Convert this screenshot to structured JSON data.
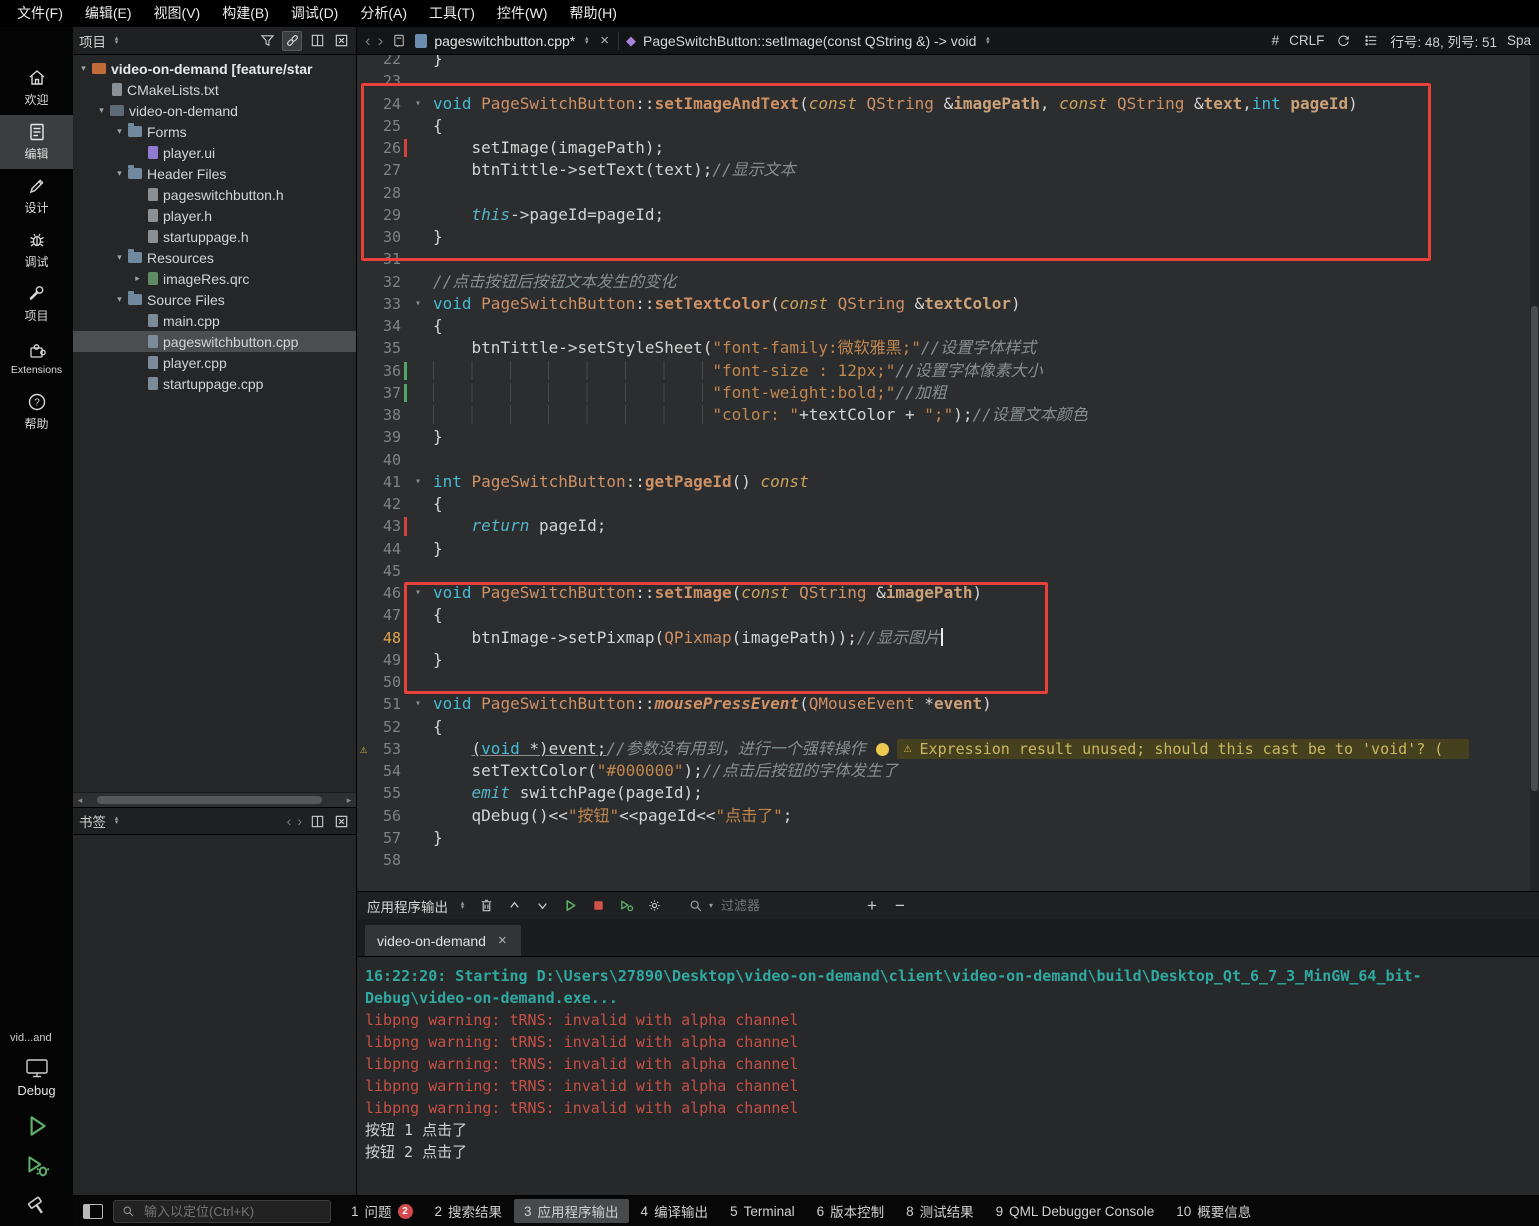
{
  "menubar": {
    "items": [
      "文件(F)",
      "编辑(E)",
      "视图(V)",
      "构建(B)",
      "调试(D)",
      "分析(A)",
      "工具(T)",
      "控件(W)",
      "帮助(H)"
    ]
  },
  "modebar": {
    "items": [
      {
        "label": "欢迎"
      },
      {
        "label": "编辑",
        "active": true
      },
      {
        "label": "设计"
      },
      {
        "label": "调试"
      },
      {
        "label": "项目"
      },
      {
        "label": "Extensions"
      },
      {
        "label": "帮助"
      }
    ],
    "kit_project": "vid...and",
    "kit_config": "Debug"
  },
  "project_pane": {
    "title": "项目",
    "tree": [
      {
        "d": 0,
        "arrow": "▾",
        "icon": "project",
        "label": "video-on-demand [feature/star",
        "bold": true
      },
      {
        "d": 1,
        "arrow": "",
        "icon": "file",
        "label": "CMakeLists.txt"
      },
      {
        "d": 1,
        "arrow": "▾",
        "icon": "app",
        "label": "video-on-demand"
      },
      {
        "d": 2,
        "arrow": "▾",
        "icon": "folder",
        "label": "Forms"
      },
      {
        "d": 3,
        "arrow": "",
        "icon": "ui",
        "label": "player.ui"
      },
      {
        "d": 2,
        "arrow": "▾",
        "icon": "folder",
        "label": "Header Files"
      },
      {
        "d": 3,
        "arrow": "",
        "icon": "h",
        "label": "pageswitchbutton.h"
      },
      {
        "d": 3,
        "arrow": "",
        "icon": "h",
        "label": "player.h"
      },
      {
        "d": 3,
        "arrow": "",
        "icon": "h",
        "label": "startuppage.h"
      },
      {
        "d": 2,
        "arrow": "▾",
        "icon": "folder",
        "label": "Resources"
      },
      {
        "d": 3,
        "arrow": "▸",
        "icon": "qrc",
        "label": "imageRes.qrc"
      },
      {
        "d": 2,
        "arrow": "▾",
        "icon": "folder",
        "label": "Source Files"
      },
      {
        "d": 3,
        "arrow": "",
        "icon": "cpp",
        "label": "main.cpp"
      },
      {
        "d": 3,
        "arrow": "",
        "icon": "cpp",
        "label": "pageswitchbutton.cpp",
        "selected": true
      },
      {
        "d": 3,
        "arrow": "",
        "icon": "cpp",
        "label": "player.cpp"
      },
      {
        "d": 3,
        "arrow": "",
        "icon": "cpp",
        "label": "startuppage.cpp"
      }
    ]
  },
  "bookmarks_pane": {
    "title": "书签"
  },
  "editor_toolbar": {
    "back": "‹",
    "forward": "›",
    "file": "pageswitchbutton.cpp*",
    "close": "×",
    "symbol": "PageSwitchButton::setImage(const QString &) -> void",
    "hash": "#",
    "line_ending": "CRLF",
    "cursor_pos": "行号: 48, 列号: 51",
    "trail": "Spa"
  },
  "editor": {
    "annotations": {
      "box_color": "#E8413C",
      "boxes": [
        {
          "covers_lines": "24-30"
        },
        {
          "covers_lines": "46-49"
        }
      ]
    },
    "lines": [
      {
        "n": 22,
        "segs": [
          [
            "o",
            "}"
          ]
        ]
      },
      {
        "n": 23,
        "segs": []
      },
      {
        "n": 24,
        "fold": true,
        "segs": [
          [
            "k",
            "void "
          ],
          [
            "t",
            "PageSwitchButton"
          ],
          [
            "o",
            "::"
          ],
          [
            "fn",
            "setImageAndText"
          ],
          [
            "o",
            "("
          ],
          [
            "kc",
            "const "
          ],
          [
            "t",
            "QString "
          ],
          [
            "o",
            "&"
          ],
          [
            "p",
            "imagePath"
          ],
          [
            "o",
            ", "
          ],
          [
            "kc",
            "const "
          ],
          [
            "t",
            "QString "
          ],
          [
            "o",
            "&"
          ],
          [
            "p",
            "text"
          ],
          [
            "o",
            ","
          ],
          [
            "k",
            "int "
          ],
          [
            "p",
            "pageId"
          ],
          [
            "o",
            ")"
          ]
        ]
      },
      {
        "n": 25,
        "segs": [
          [
            "o",
            "{"
          ]
        ]
      },
      {
        "n": 26,
        "mark": "red",
        "segs": [
          [
            "o",
            "    setImage(imagePath);"
          ]
        ]
      },
      {
        "n": 27,
        "segs": [
          [
            "o",
            "    btnTittle->setText(text);"
          ],
          [
            "c",
            "//显示文本"
          ]
        ]
      },
      {
        "n": 28,
        "segs": []
      },
      {
        "n": 29,
        "segs": [
          [
            "o",
            "    "
          ],
          [
            "kf",
            "this"
          ],
          [
            "o",
            "->pageId=pageId;"
          ]
        ]
      },
      {
        "n": 30,
        "segs": [
          [
            "o",
            "}"
          ]
        ]
      },
      {
        "n": 31,
        "segs": []
      },
      {
        "n": 32,
        "segs": [
          [
            "c",
            "//点击按钮后按钮文本发生的变化"
          ]
        ]
      },
      {
        "n": 33,
        "fold": true,
        "segs": [
          [
            "k",
            "void "
          ],
          [
            "t",
            "PageSwitchButton"
          ],
          [
            "o",
            "::"
          ],
          [
            "fn",
            "setTextColor"
          ],
          [
            "o",
            "("
          ],
          [
            "kc",
            "const "
          ],
          [
            "t",
            "QString "
          ],
          [
            "o",
            "&"
          ],
          [
            "p",
            "textColor"
          ],
          [
            "o",
            ")"
          ]
        ]
      },
      {
        "n": 34,
        "segs": [
          [
            "o",
            "{"
          ]
        ]
      },
      {
        "n": 35,
        "segs": [
          [
            "o",
            "    btnTittle->setStyleSheet("
          ],
          [
            "s",
            "\"font-family:微软雅黑;\""
          ],
          [
            "c",
            "//设置字体样式"
          ]
        ]
      },
      {
        "n": 36,
        "mark": "green",
        "segs": [
          [
            "g",
            "                             "
          ],
          [
            "s",
            "\"font-size : 12px;\""
          ],
          [
            "c",
            "//设置字体像素大小"
          ]
        ]
      },
      {
        "n": 37,
        "mark": "green",
        "segs": [
          [
            "g",
            "                             "
          ],
          [
            "s",
            "\"font-weight:bold;\""
          ],
          [
            "c",
            "//加粗"
          ]
        ]
      },
      {
        "n": 38,
        "segs": [
          [
            "g",
            "                             "
          ],
          [
            "s",
            "\"color: \""
          ],
          [
            "o",
            "+textColor + "
          ],
          [
            "s",
            "\";\""
          ],
          [
            "o",
            ");"
          ],
          [
            "c",
            "//设置文本颜色"
          ]
        ]
      },
      {
        "n": 39,
        "segs": [
          [
            "o",
            "}"
          ]
        ]
      },
      {
        "n": 40,
        "segs": []
      },
      {
        "n": 41,
        "fold": true,
        "segs": [
          [
            "k",
            "int "
          ],
          [
            "t",
            "PageSwitchButton"
          ],
          [
            "o",
            "::"
          ],
          [
            "fn",
            "getPageId"
          ],
          [
            "o",
            "() "
          ],
          [
            "kc",
            "const"
          ]
        ]
      },
      {
        "n": 42,
        "segs": [
          [
            "o",
            "{"
          ]
        ]
      },
      {
        "n": 43,
        "mark": "red",
        "segs": [
          [
            "o",
            "    "
          ],
          [
            "kf",
            "return"
          ],
          [
            "o",
            " pageId;"
          ]
        ]
      },
      {
        "n": 44,
        "segs": [
          [
            "o",
            "}"
          ]
        ]
      },
      {
        "n": 45,
        "segs": []
      },
      {
        "n": 46,
        "fold": true,
        "segs": [
          [
            "k",
            "void "
          ],
          [
            "t",
            "PageSwitchButton"
          ],
          [
            "o",
            "::"
          ],
          [
            "fn",
            "setImage"
          ],
          [
            "o",
            "("
          ],
          [
            "kc",
            "const "
          ],
          [
            "t",
            "QString "
          ],
          [
            "o",
            "&"
          ],
          [
            "p",
            "imagePath"
          ],
          [
            "o",
            ")"
          ]
        ]
      },
      {
        "n": 47,
        "segs": [
          [
            "o",
            "{"
          ]
        ]
      },
      {
        "n": 48,
        "cur": true,
        "segs": [
          [
            "o",
            "    btnImage->setPixmap("
          ],
          [
            "t",
            "QPixmap"
          ],
          [
            "o",
            "(imagePath));"
          ],
          [
            "c",
            "//显示图片"
          ],
          [
            "cursor",
            ""
          ]
        ]
      },
      {
        "n": 49,
        "segs": [
          [
            "o",
            "}"
          ]
        ]
      },
      {
        "n": 50,
        "segs": []
      },
      {
        "n": 51,
        "fold": true,
        "segs": [
          [
            "k",
            "void "
          ],
          [
            "t",
            "PageSwitchButton"
          ],
          [
            "o",
            "::"
          ],
          [
            "vf",
            "mousePressEvent"
          ],
          [
            "o",
            "("
          ],
          [
            "t",
            "QMouseEvent "
          ],
          [
            "o",
            "*"
          ],
          [
            "p",
            "event"
          ],
          [
            "o",
            ")"
          ]
        ]
      },
      {
        "n": 52,
        "segs": [
          [
            "o",
            "{"
          ]
        ]
      },
      {
        "n": 53,
        "warn": true,
        "segs": [
          [
            "o",
            "    "
          ],
          [
            "o u",
            "("
          ],
          [
            "k u",
            "void"
          ],
          [
            "o u",
            " *)event;"
          ],
          [
            "c",
            "//参数没有用到，进行一个强转操作"
          ],
          [
            "bulb",
            ""
          ],
          [
            "chip",
            "Expression result unused; should this cast be to 'void'? ("
          ]
        ]
      },
      {
        "n": 54,
        "segs": [
          [
            "o",
            "    setTextColor("
          ],
          [
            "s",
            "\"#000000\""
          ],
          [
            "o",
            ");"
          ],
          [
            "c",
            "//点击后按钮的字体发生了"
          ]
        ]
      },
      {
        "n": 55,
        "segs": [
          [
            "o",
            "    "
          ],
          [
            "kf",
            "emit"
          ],
          [
            "o",
            " switchPage(pageId);"
          ]
        ]
      },
      {
        "n": 56,
        "segs": [
          [
            "o",
            "    qDebug()<<"
          ],
          [
            "s",
            "\"按钮\""
          ],
          [
            "o",
            "<<pageId<<"
          ],
          [
            "s",
            "\"点击了\""
          ],
          [
            "o",
            ";"
          ]
        ]
      },
      {
        "n": 57,
        "segs": [
          [
            "o",
            "}"
          ]
        ]
      },
      {
        "n": 58,
        "segs": []
      }
    ]
  },
  "output_pane": {
    "title": "应用程序输出",
    "filter_placeholder": "过滤器",
    "tab": "video-on-demand",
    "tab_close": "×",
    "lines": [
      {
        "cls": "info",
        "text": "16:22:20: Starting D:\\Users\\27890\\Desktop\\video-on-demand\\client\\video-on-demand\\build\\Desktop_Qt_6_7_3_MinGW_64_bit-"
      },
      {
        "cls": "info",
        "text": "Debug\\video-on-demand.exe..."
      },
      {
        "cls": "err",
        "text": "libpng warning: tRNS: invalid with alpha channel"
      },
      {
        "cls": "err",
        "text": "libpng warning: tRNS: invalid with alpha channel"
      },
      {
        "cls": "err",
        "text": "libpng warning: tRNS: invalid with alpha channel"
      },
      {
        "cls": "err",
        "text": "libpng warning: tRNS: invalid with alpha channel"
      },
      {
        "cls": "err",
        "text": "libpng warning: tRNS: invalid with alpha channel"
      },
      {
        "cls": "plain",
        "text": "按钮 1 点击了"
      },
      {
        "cls": "plain",
        "text": "按钮 2 点击了"
      }
    ]
  },
  "statusbar": {
    "locator_placeholder": "输入以定位(Ctrl+K)",
    "buttons": [
      {
        "num": "1",
        "label": "问题",
        "badge": "2"
      },
      {
        "num": "2",
        "label": "搜索结果"
      },
      {
        "num": "3",
        "label": "应用程序输出",
        "active": true
      },
      {
        "num": "4",
        "label": "编译输出"
      },
      {
        "num": "5",
        "label": "Terminal"
      },
      {
        "num": "6",
        "label": "版本控制"
      },
      {
        "num": "8",
        "label": "测试结果"
      },
      {
        "num": "9",
        "label": "QML Debugger Console"
      },
      {
        "num": "10",
        "label": "概要信息"
      }
    ]
  }
}
